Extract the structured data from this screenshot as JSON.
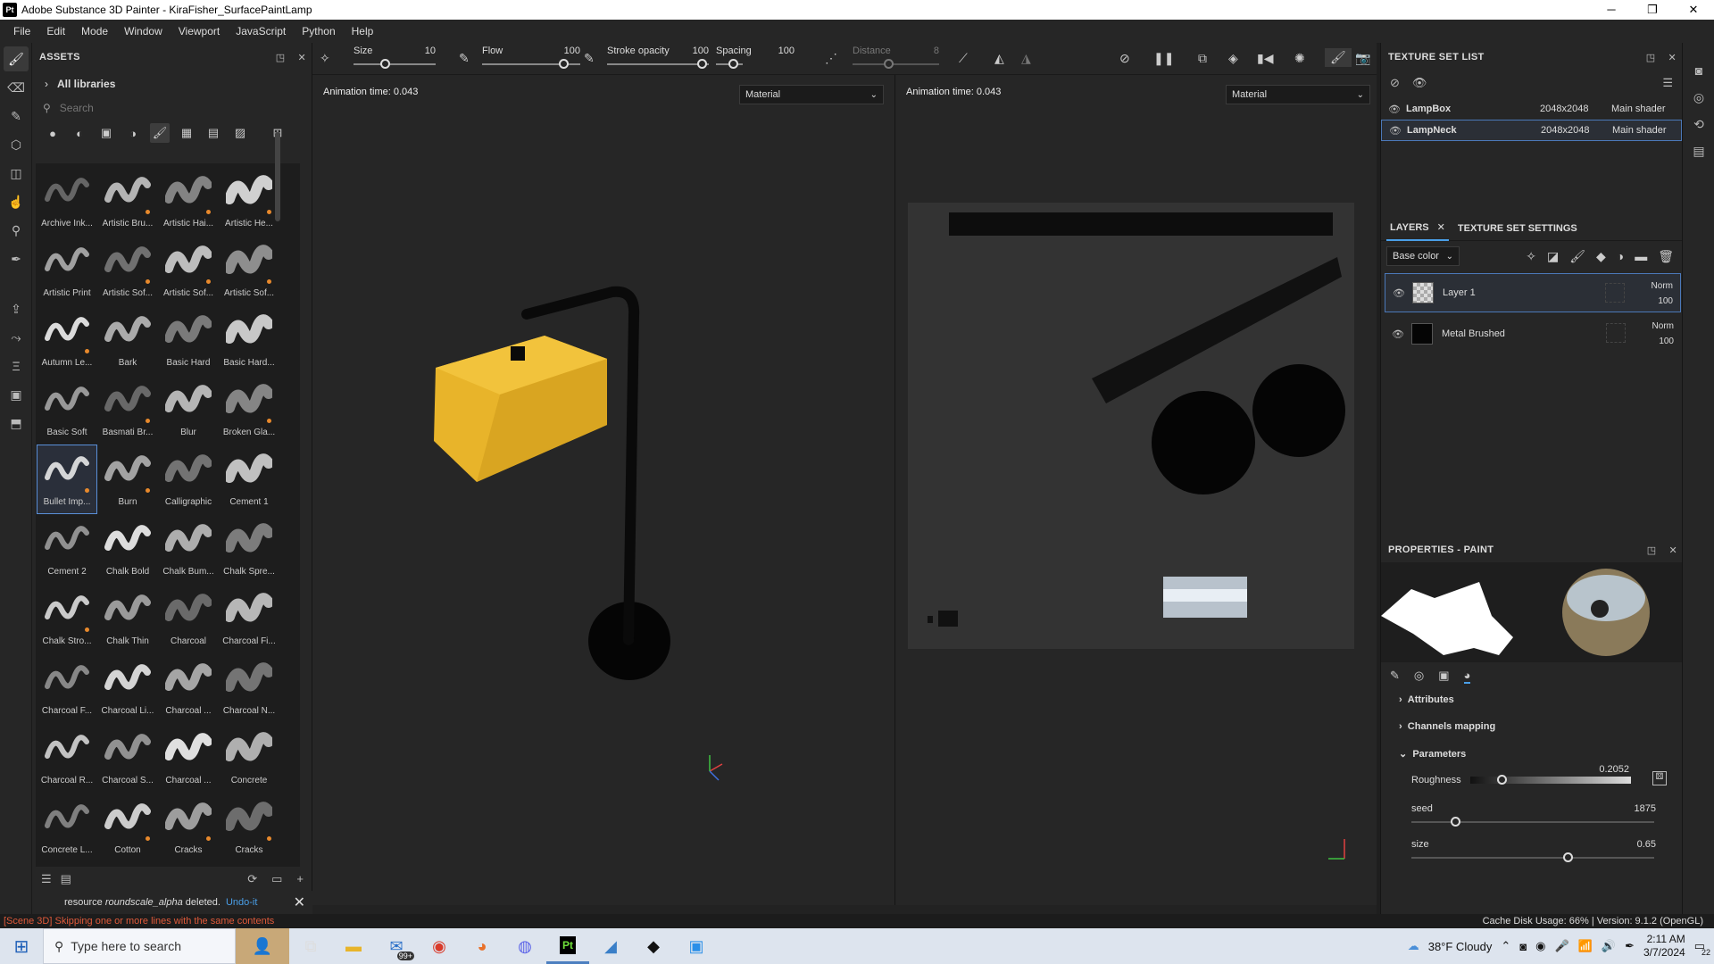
{
  "window": {
    "app_icon": "Pt",
    "title": "Adobe Substance 3D Painter - KiraFisher_SurfacePaintLamp",
    "min": "─",
    "max": "❐",
    "close": "✕"
  },
  "menu": [
    "File",
    "Edit",
    "Mode",
    "Window",
    "Viewport",
    "JavaScript",
    "Python",
    "Help"
  ],
  "assets": {
    "title": "ASSETS",
    "library": "All libraries",
    "search_placeholder": "Search",
    "items": [
      {
        "label": "Archive Ink...",
        "sel": false,
        "dot": false
      },
      {
        "label": "Artistic Bru...",
        "dot": true
      },
      {
        "label": "Artistic Hai...",
        "dot": true
      },
      {
        "label": "Artistic He...",
        "dot": true
      },
      {
        "label": "Artistic Print",
        "dot": false
      },
      {
        "label": "Artistic Sof...",
        "dot": true
      },
      {
        "label": "Artistic Sof...",
        "dot": true
      },
      {
        "label": "Artistic Sof...",
        "dot": true
      },
      {
        "label": "Autumn Le...",
        "dot": true
      },
      {
        "label": "Bark",
        "dot": false
      },
      {
        "label": "Basic Hard",
        "dot": false
      },
      {
        "label": "Basic Hard...",
        "dot": false
      },
      {
        "label": "Basic Soft",
        "dot": false
      },
      {
        "label": "Basmati Br...",
        "dot": true
      },
      {
        "label": "Blur",
        "dot": false
      },
      {
        "label": "Broken Gla...",
        "dot": true
      },
      {
        "label": "Bullet Imp...",
        "dot": true,
        "sel": true
      },
      {
        "label": "Burn",
        "dot": true
      },
      {
        "label": "Calligraphic",
        "dot": false
      },
      {
        "label": "Cement 1",
        "dot": false
      },
      {
        "label": "Cement 2",
        "dot": false
      },
      {
        "label": "Chalk Bold",
        "dot": false
      },
      {
        "label": "Chalk Bum...",
        "dot": false
      },
      {
        "label": "Chalk Spre...",
        "dot": false
      },
      {
        "label": "Chalk Stro...",
        "dot": true
      },
      {
        "label": "Chalk Thin",
        "dot": false
      },
      {
        "label": "Charcoal",
        "dot": false
      },
      {
        "label": "Charcoal Fi...",
        "dot": false
      },
      {
        "label": "Charcoal F...",
        "dot": false
      },
      {
        "label": "Charcoal Li...",
        "dot": false
      },
      {
        "label": "Charcoal ...",
        "dot": false
      },
      {
        "label": "Charcoal N...",
        "dot": false
      },
      {
        "label": "Charcoal R...",
        "dot": false
      },
      {
        "label": "Charcoal S...",
        "dot": false
      },
      {
        "label": "Charcoal ...",
        "dot": false
      },
      {
        "label": "Concrete",
        "dot": false
      },
      {
        "label": "Concrete L...",
        "dot": false
      },
      {
        "label": "Cotton",
        "dot": true
      },
      {
        "label": "Cracks",
        "dot": true
      },
      {
        "label": "Cracks",
        "dot": true
      }
    ],
    "notice_prefix": "resource",
    "notice_resource": "roundscale_alpha",
    "notice_suffix": "deleted.",
    "notice_undo": "Undo-it"
  },
  "toolbar": {
    "size_label": "Size",
    "size_value": "10",
    "flow_label": "Flow",
    "flow_value": "100",
    "stroke_label": "Stroke opacity",
    "stroke_value": "100",
    "spacing_label": "Spacing",
    "spacing_value": "100",
    "distance_label": "Distance",
    "distance_value": "8"
  },
  "viewport3d": {
    "anim": "Animation time: 0.043",
    "material": "Material"
  },
  "viewport2d": {
    "anim": "Animation time: 0.043",
    "material": "Material"
  },
  "texture_set_list": {
    "title": "TEXTURE SET LIST",
    "rows": [
      {
        "name": "LampBox",
        "res": "2048x2048",
        "shader": "Main shader"
      },
      {
        "name": "LampNeck",
        "res": "2048x2048",
        "shader": "Main shader"
      }
    ]
  },
  "layers": {
    "tab_layers": "LAYERS",
    "tab_settings": "TEXTURE SET SETTINGS",
    "channel": "Base color",
    "items": [
      {
        "name": "Layer 1",
        "blend": "Norm",
        "opacity": "100"
      },
      {
        "name": "Metal Brushed",
        "blend": "Norm",
        "opacity": "100"
      }
    ]
  },
  "properties": {
    "title": "PROPERTIES - PAINT",
    "sections": [
      "Attributes",
      "Channels mapping",
      "Parameters"
    ],
    "roughness_label": "Roughness",
    "roughness_value": "0.2052",
    "seed_label": "seed",
    "seed_value": "1875",
    "size_label": "size",
    "size_value": "0.65"
  },
  "status": {
    "error": "[Scene 3D] Skipping one or more lines with the same contents",
    "right": "Cache Disk Usage:   66% | Version: 9.1.2 (OpenGL)"
  },
  "taskbar": {
    "search_placeholder": "Type here to search",
    "mail_badge": "99+",
    "weather": "38°F  Cloudy",
    "time": "2:11 AM",
    "date": "3/7/2024",
    "notif": "22"
  },
  "colors": {
    "accent": "#4a9fe8",
    "lamp_yellow": "#e8b42a",
    "orange_dot": "#e8892c",
    "error": "#e05a3a"
  }
}
